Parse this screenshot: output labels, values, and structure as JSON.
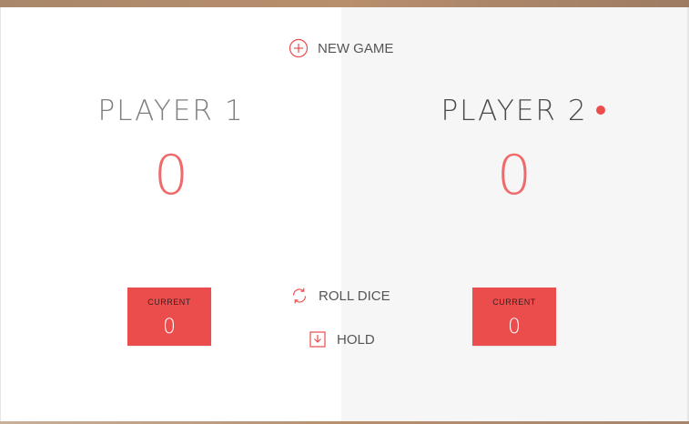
{
  "game": {
    "new_game_label": "NEW GAME",
    "roll_dice_label": "ROLL DICE",
    "hold_label": "HOLD",
    "accent_color": "#eb4d4d"
  },
  "players": [
    {
      "name": "PLAYER 1",
      "score": "0",
      "current_label": "CURRENT",
      "current_score": "0",
      "active": false
    },
    {
      "name": "PLAYER 2",
      "score": "0",
      "current_label": "CURRENT",
      "current_score": "0",
      "active": true
    }
  ],
  "icons": {
    "new_game": "plus-circle-icon",
    "roll_dice": "refresh-icon",
    "hold": "download-icon"
  }
}
